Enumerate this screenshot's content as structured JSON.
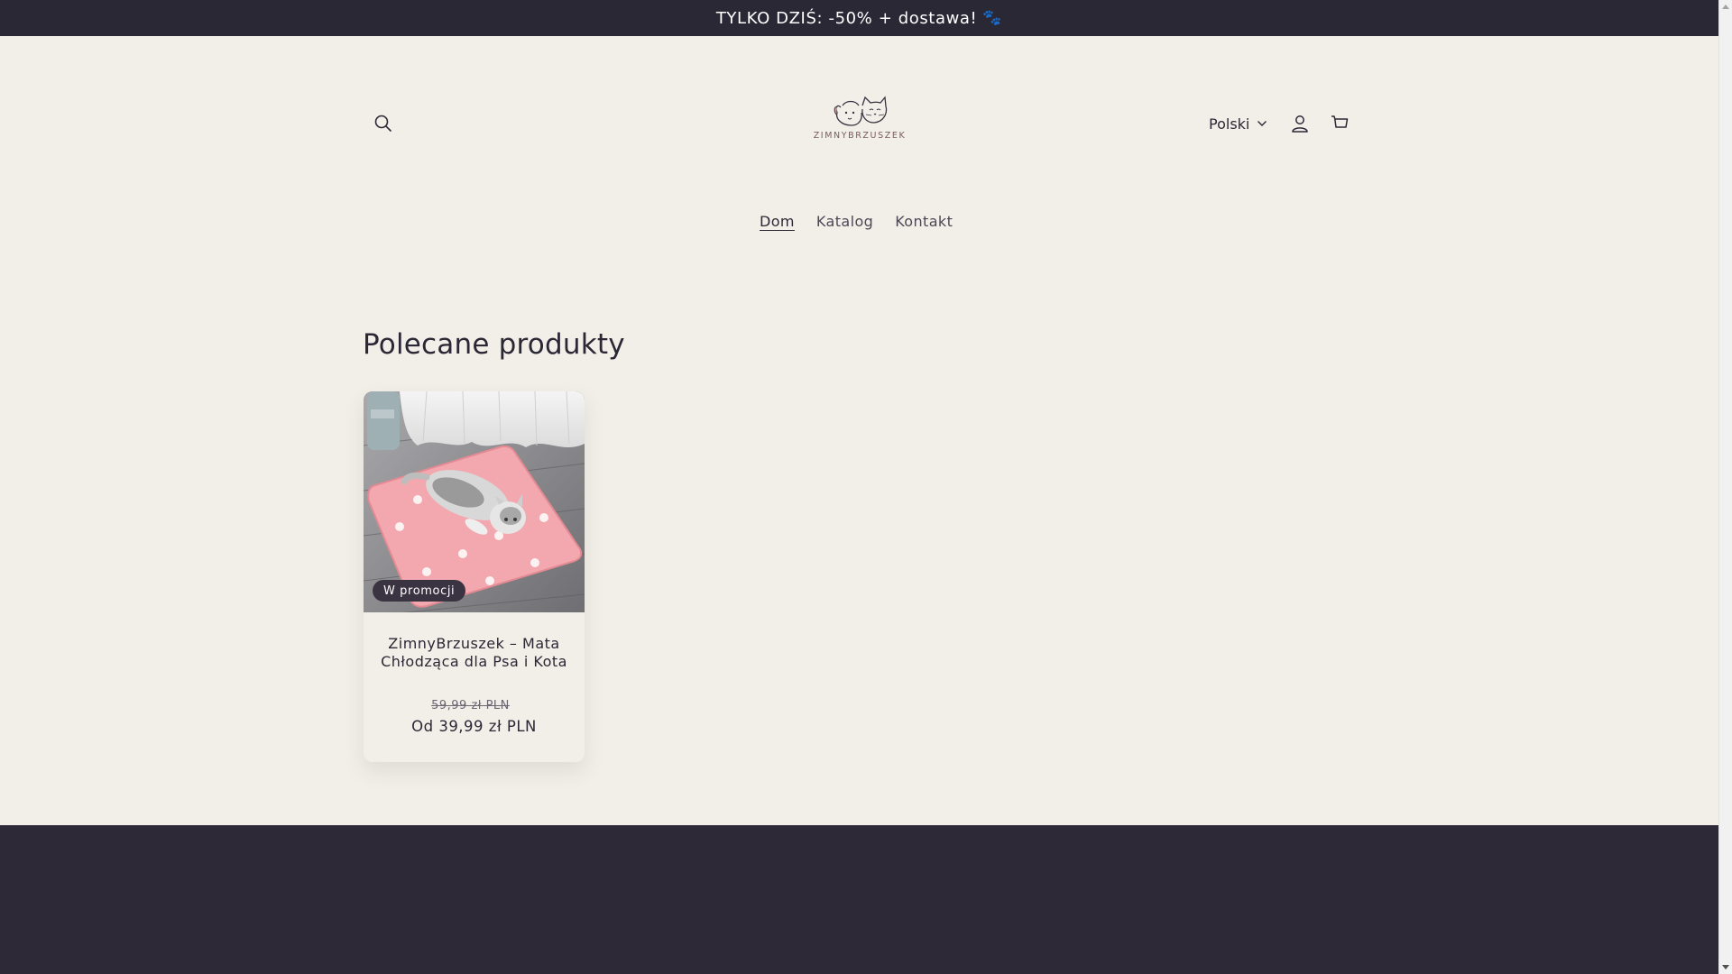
{
  "announcement": {
    "text": "TYLKO DZIŚ: -50% + dostawa!",
    "emoji": "🐾"
  },
  "header": {
    "logo_text": "ZIMNYBRZUSZEK",
    "language": "Polski",
    "icons": [
      "search-icon",
      "account-icon",
      "cart-icon",
      "chevron-down-icon"
    ]
  },
  "nav": {
    "items": [
      {
        "label": "Dom",
        "active": true
      },
      {
        "label": "Katalog",
        "active": false
      },
      {
        "label": "Kontakt",
        "active": false
      }
    ]
  },
  "featured": {
    "title": "Polecane produkty",
    "products": [
      {
        "badge": "W promocji",
        "title": "ZimnyBrzuszek – Mata Chłodząca dla Psa i Kota",
        "price_old": "59,99 zł PLN",
        "price_new": "Od 39,99 zł PLN"
      }
    ]
  },
  "colors": {
    "background": "#f2efe9",
    "dark": "#2b2836",
    "footer": "#2d2937",
    "mat_pink": "#f2a8ae"
  }
}
